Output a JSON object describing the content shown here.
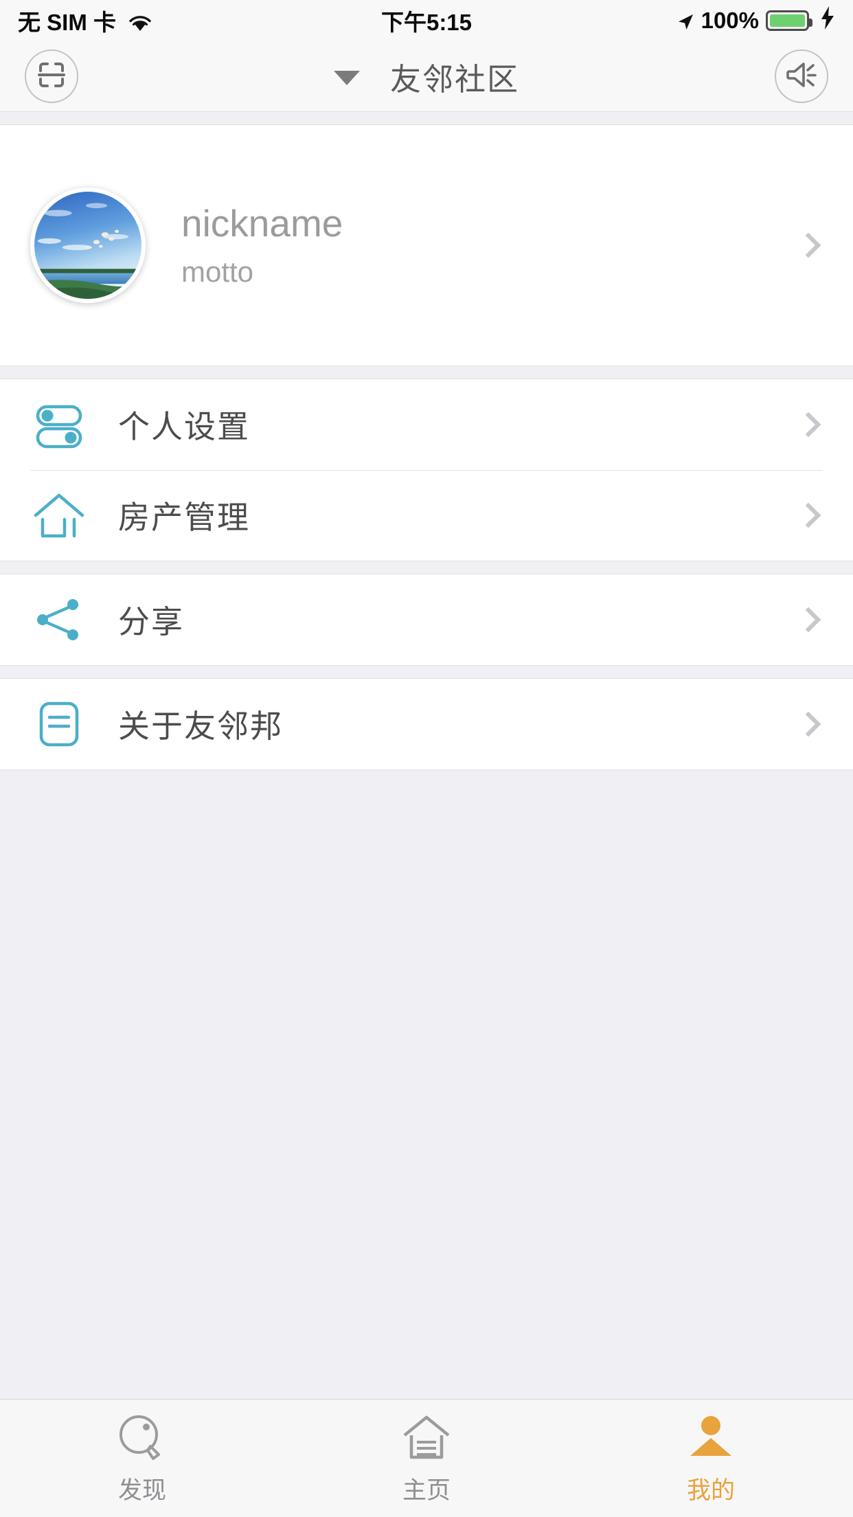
{
  "statusbar": {
    "carrier": "无 SIM 卡",
    "wifi_icon": "wifi-icon",
    "time": "下午5:15",
    "location_icon": "location-arrow-icon",
    "battery_percent": "100%",
    "battery_icon": "battery-icon",
    "charging_icon": "lightning-bolt-icon",
    "battery_color": "#6ed06e"
  },
  "navbar": {
    "scan_icon": "scan-qr-icon",
    "caret_icon": "caret-down-icon",
    "title": "友邻社区",
    "announce_icon": "megaphone-icon"
  },
  "profile": {
    "avatar_icon": "avatar-photo",
    "nickname": "nickname",
    "motto": "motto",
    "chevron_icon": "chevron-right-icon"
  },
  "menu_groups": [
    {
      "items": [
        {
          "icon": "toggle-switches-icon",
          "label": "个人设置",
          "chevron": "chevron-right-icon"
        },
        {
          "icon": "house-icon",
          "label": "房产管理",
          "chevron": "chevron-right-icon"
        }
      ]
    },
    {
      "items": [
        {
          "icon": "share-nodes-icon",
          "label": "分享",
          "chevron": "chevron-right-icon"
        }
      ]
    },
    {
      "items": [
        {
          "icon": "document-lines-icon",
          "label": "关于友邻邦",
          "chevron": "chevron-right-icon"
        }
      ]
    }
  ],
  "tabbar": {
    "active_color": "#e8a33d",
    "inactive_color": "#8e8e93",
    "tabs": [
      {
        "icon": "discover-compass-icon",
        "label": "发现",
        "active": false
      },
      {
        "icon": "home-icon",
        "label": "主页",
        "active": false
      },
      {
        "icon": "person-icon",
        "label": "我的",
        "active": true
      }
    ]
  },
  "theme": {
    "accent_teal": "#4bafc9",
    "text_gray": "#4c4c4c",
    "bg_gray": "#efeff4"
  }
}
